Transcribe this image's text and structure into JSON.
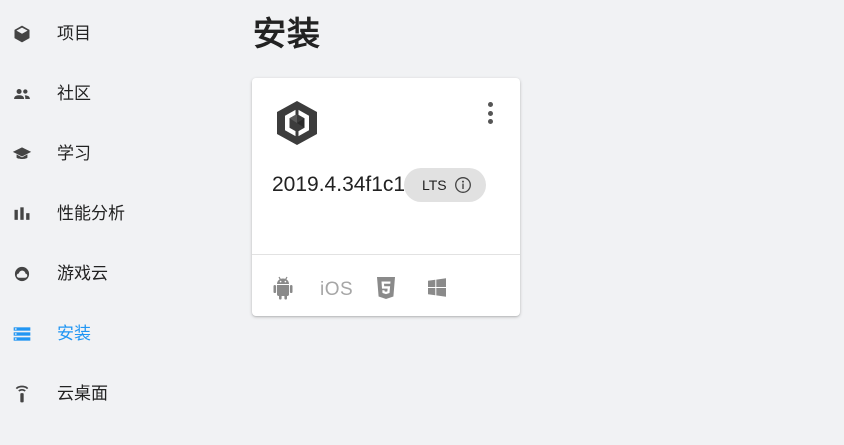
{
  "sidebar": {
    "items": [
      {
        "label": "项目",
        "icon": "cube-icon"
      },
      {
        "label": "社区",
        "icon": "people-icon"
      },
      {
        "label": "学习",
        "icon": "graduation-cap-icon"
      },
      {
        "label": "性能分析",
        "icon": "bar-chart-icon"
      },
      {
        "label": "游戏云",
        "icon": "cloud-icon"
      },
      {
        "label": "安装",
        "icon": "installs-icon",
        "active": true
      },
      {
        "label": "云桌面",
        "icon": "remote-desktop-icon"
      }
    ]
  },
  "main": {
    "title": "安装",
    "card": {
      "version": "2019.4.34f1c1",
      "badge": "LTS",
      "platforms": [
        "android-icon",
        "iOS",
        "html5-icon",
        "windows-icon"
      ],
      "ios_label": "iOS"
    }
  },
  "colors": {
    "accent": "#2196f3",
    "background": "#f1f2f4",
    "card": "#ffffff",
    "badge": "#e1e1e1"
  }
}
